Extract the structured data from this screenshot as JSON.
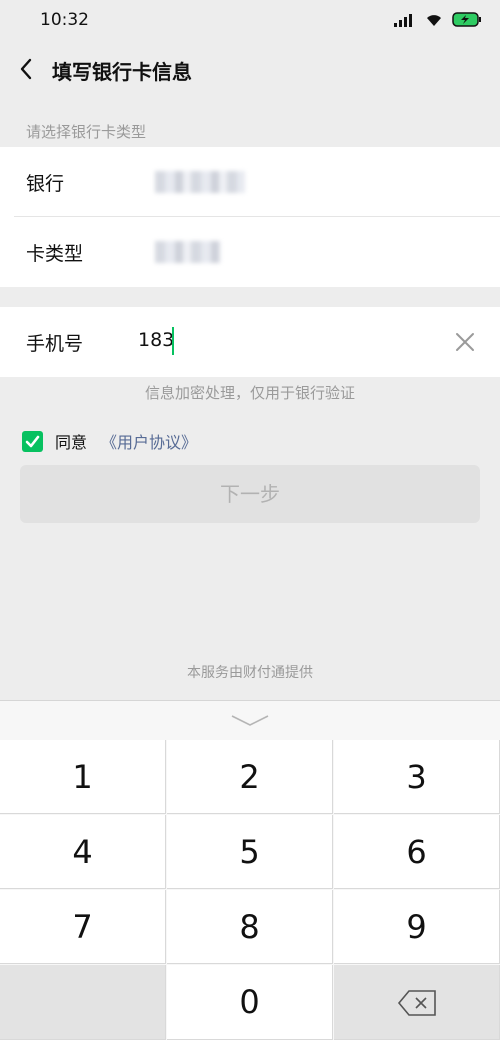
{
  "status_bar": {
    "time": "10:32"
  },
  "nav": {
    "title": "填写银行卡信息"
  },
  "section": {
    "label": "请选择银行卡类型"
  },
  "bank_fields": [
    {
      "label": "银行"
    },
    {
      "label": "卡类型"
    }
  ],
  "phone": {
    "label": "手机号",
    "value": "183"
  },
  "hint": "信息加密处理，仅用于银行验证",
  "agree": {
    "text": "同意",
    "link": "《用户协议》",
    "checked": true
  },
  "next_button": {
    "label": "下一步"
  },
  "footer_note": "本服务由财付通提供",
  "keyboard": {
    "keys": [
      "1",
      "2",
      "3",
      "4",
      "5",
      "6",
      "7",
      "8",
      "9",
      "0"
    ]
  },
  "colors": {
    "accent": "#07c160",
    "link": "#576b95",
    "background": "#ededed"
  }
}
